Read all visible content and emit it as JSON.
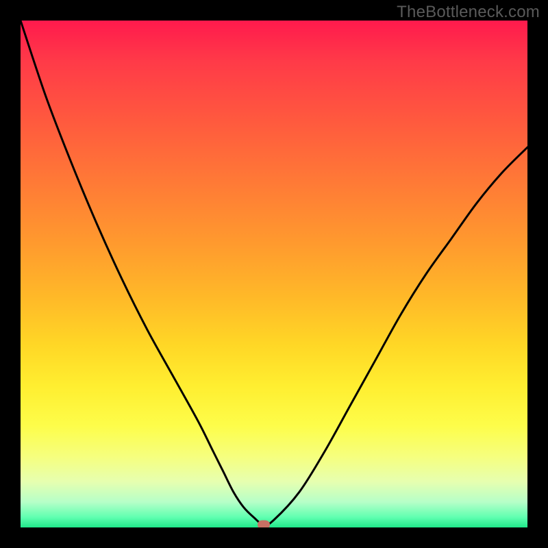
{
  "watermark": "TheBottleneck.com",
  "chart_data": {
    "type": "line",
    "title": "",
    "xlabel": "",
    "ylabel": "",
    "xlim": [
      0,
      100
    ],
    "ylim": [
      0,
      100
    ],
    "grid": false,
    "legend": false,
    "background": "rainbow-vertical-gradient",
    "series": [
      {
        "name": "bottleneck-curve",
        "color": "#000000",
        "x": [
          0,
          5,
          10,
          15,
          20,
          25,
          30,
          35,
          38,
          40,
          42,
          44,
          46,
          48,
          50,
          55,
          60,
          65,
          70,
          75,
          80,
          85,
          90,
          95,
          100
        ],
        "y": [
          100,
          85,
          72,
          60,
          49,
          39,
          30,
          21,
          15,
          11,
          7,
          4,
          2,
          0.5,
          1.5,
          7,
          15,
          24,
          33,
          42,
          50,
          57,
          64,
          70,
          75
        ]
      }
    ],
    "marker": {
      "x": 48,
      "y": 0.5,
      "color": "#c77064"
    }
  }
}
